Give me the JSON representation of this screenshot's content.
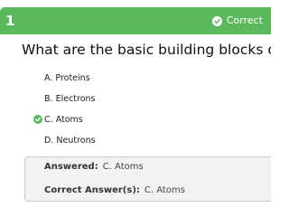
{
  "question": {
    "number": "1",
    "status": "Correct",
    "text": "What are the basic building blocks of matter?"
  },
  "options": [
    {
      "letter": "A.",
      "text": "Proteins"
    },
    {
      "letter": "B.",
      "text": "Electrons"
    },
    {
      "letter": "C.",
      "text": "Atoms"
    },
    {
      "letter": "D.",
      "text": "Neutrons"
    }
  ],
  "summary": {
    "answered_label": "Answered:",
    "answered_value": "C. Atoms",
    "correct_label": "Correct Answer(s):",
    "correct_value": "C. Atoms"
  },
  "colors": {
    "header": "#5cb85c",
    "check": "#5cb85c"
  },
  "icons": {
    "status": "check-circle-icon",
    "selected_option": "check-circle-icon"
  }
}
